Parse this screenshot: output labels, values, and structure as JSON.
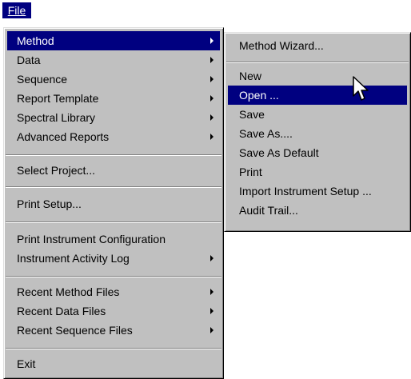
{
  "menubar": {
    "file_label": "File"
  },
  "file_menu": {
    "items": [
      {
        "label": "Method",
        "has_submenu": true
      },
      {
        "label": "Data",
        "has_submenu": true
      },
      {
        "label": "Sequence",
        "has_submenu": true
      },
      {
        "label": "Report Template",
        "has_submenu": true
      },
      {
        "label": "Spectral Library",
        "has_submenu": true
      },
      {
        "label": "Advanced Reports",
        "has_submenu": true
      },
      {
        "label": "Select Project..."
      },
      {
        "label": "Print Setup..."
      },
      {
        "label": "Print Instrument Configuration"
      },
      {
        "label": "Instrument Activity Log",
        "has_submenu": true
      },
      {
        "label": "Recent Method Files",
        "has_submenu": true
      },
      {
        "label": "Recent Data Files",
        "has_submenu": true
      },
      {
        "label": "Recent Sequence Files",
        "has_submenu": true
      },
      {
        "label": "Exit"
      }
    ],
    "highlighted": "Method"
  },
  "method_submenu": {
    "items": [
      {
        "label": "Method Wizard..."
      },
      {
        "label": "New"
      },
      {
        "label": "Open ..."
      },
      {
        "label": "Save"
      },
      {
        "label": "Save As...."
      },
      {
        "label": "Save As Default"
      },
      {
        "label": "Print"
      },
      {
        "label": "Import Instrument Setup ..."
      },
      {
        "label": "Audit Trail..."
      }
    ],
    "highlighted": "Open ..."
  },
  "colors": {
    "highlight": "#000080",
    "menu_bg": "#c0c0c0"
  },
  "cursor": "arrow-pointer-icon"
}
